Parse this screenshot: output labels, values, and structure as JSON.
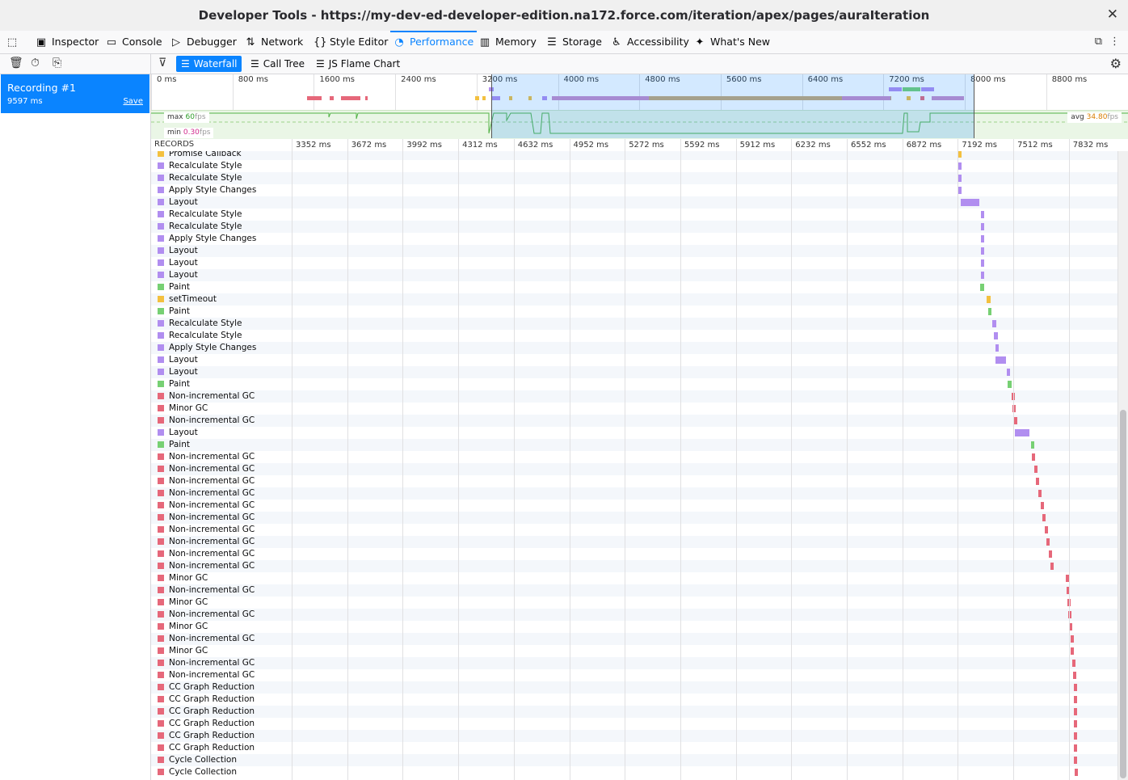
{
  "window": {
    "title": "Developer Tools - https://my-dev-ed-developer-edition.na172.force.com/iteration/apex/pages/auraIteration",
    "close_icon": "close-icon"
  },
  "tabs": [
    {
      "label": "Inspector",
      "icon": "inspector-icon"
    },
    {
      "label": "Console",
      "icon": "console-icon"
    },
    {
      "label": "Debugger",
      "icon": "debugger-icon"
    },
    {
      "label": "Network",
      "icon": "network-icon"
    },
    {
      "label": "Style Editor",
      "icon": "style-editor-icon"
    },
    {
      "label": "Performance",
      "icon": "performance-icon",
      "selected": true
    },
    {
      "label": "Memory",
      "icon": "memory-icon"
    },
    {
      "label": "Storage",
      "icon": "storage-icon"
    },
    {
      "label": "Accessibility",
      "icon": "accessibility-icon"
    },
    {
      "label": "What's New",
      "icon": "whats-new-icon"
    }
  ],
  "subtabs": [
    {
      "label": "Waterfall",
      "selected": true
    },
    {
      "label": "Call Tree"
    },
    {
      "label": "JS Flame Chart"
    }
  ],
  "recording": {
    "name": "Recording #1",
    "duration": "9597 ms",
    "save": "Save"
  },
  "overview": {
    "ticks": [
      "0 ms",
      "800 ms",
      "1600 ms",
      "2400 ms",
      "3200 ms",
      "4000 ms",
      "4800 ms",
      "5600 ms",
      "6400 ms",
      "7200 ms",
      "8000 ms",
      "8800 ms"
    ],
    "fps": {
      "max_label": "max",
      "max_value": "60",
      "min_label": "min",
      "min_value": "0.30",
      "avg_label": "avg",
      "avg_value": "34.80",
      "unit": "fps"
    }
  },
  "waterfall": {
    "header": "RECORDS",
    "ticks": [
      "3352 ms",
      "3672 ms",
      "3992 ms",
      "4312 ms",
      "4632 ms",
      "4952 ms",
      "5272 ms",
      "5592 ms",
      "5912 ms",
      "6232 ms",
      "6552 ms",
      "6872 ms",
      "7192 ms",
      "7512 ms",
      "7832 ms"
    ],
    "colors": {
      "js": "#f3c03f",
      "style": "#b18ef0",
      "paint": "#77d073",
      "gc": "#e6687a"
    },
    "records": [
      {
        "name": "Promise Callback",
        "cat": "js",
        "start": 7192,
        "dur": 20
      },
      {
        "name": "Recalculate Style",
        "cat": "style",
        "start": 7192,
        "dur": 20
      },
      {
        "name": "Recalculate Style",
        "cat": "style",
        "start": 7192,
        "dur": 20
      },
      {
        "name": "Apply Style Changes",
        "cat": "style",
        "start": 7192,
        "dur": 20
      },
      {
        "name": "Layout",
        "cat": "style",
        "start": 7210,
        "dur": 105
      },
      {
        "name": "Recalculate Style",
        "cat": "style",
        "start": 7325,
        "dur": 20
      },
      {
        "name": "Recalculate Style",
        "cat": "style",
        "start": 7325,
        "dur": 20
      },
      {
        "name": "Apply Style Changes",
        "cat": "style",
        "start": 7325,
        "dur": 20
      },
      {
        "name": "Layout",
        "cat": "style",
        "start": 7325,
        "dur": 20
      },
      {
        "name": "Layout",
        "cat": "style",
        "start": 7325,
        "dur": 20
      },
      {
        "name": "Layout",
        "cat": "style",
        "start": 7325,
        "dur": 20
      },
      {
        "name": "Paint",
        "cat": "paint",
        "start": 7322,
        "dur": 20
      },
      {
        "name": "setTimeout",
        "cat": "js",
        "start": 7360,
        "dur": 20
      },
      {
        "name": "Paint",
        "cat": "paint",
        "start": 7365,
        "dur": 20
      },
      {
        "name": "Recalculate Style",
        "cat": "style",
        "start": 7392,
        "dur": 20
      },
      {
        "name": "Recalculate Style",
        "cat": "style",
        "start": 7402,
        "dur": 20
      },
      {
        "name": "Apply Style Changes",
        "cat": "style",
        "start": 7410,
        "dur": 20
      },
      {
        "name": "Layout",
        "cat": "style",
        "start": 7410,
        "dur": 60
      },
      {
        "name": "Layout",
        "cat": "style",
        "start": 7475,
        "dur": 20
      },
      {
        "name": "Paint",
        "cat": "paint",
        "start": 7480,
        "dur": 20
      },
      {
        "name": "Non-incremental GC",
        "cat": "gc",
        "start": 7500,
        "dur": 18
      },
      {
        "name": "Minor GC",
        "cat": "gc",
        "start": 7505,
        "dur": 18
      },
      {
        "name": "Non-incremental GC",
        "cat": "gc",
        "start": 7515,
        "dur": 18
      },
      {
        "name": "Layout",
        "cat": "style",
        "start": 7522,
        "dur": 85
      },
      {
        "name": "Paint",
        "cat": "paint",
        "start": 7612,
        "dur": 20
      },
      {
        "name": "Non-incremental GC",
        "cat": "gc",
        "start": 7620,
        "dur": 18
      },
      {
        "name": "Non-incremental GC",
        "cat": "gc",
        "start": 7632,
        "dur": 18
      },
      {
        "name": "Non-incremental GC",
        "cat": "gc",
        "start": 7644,
        "dur": 18
      },
      {
        "name": "Non-incremental GC",
        "cat": "gc",
        "start": 7656,
        "dur": 18
      },
      {
        "name": "Non-incremental GC",
        "cat": "gc",
        "start": 7668,
        "dur": 18
      },
      {
        "name": "Non-incremental GC",
        "cat": "gc",
        "start": 7680,
        "dur": 18
      },
      {
        "name": "Non-incremental GC",
        "cat": "gc",
        "start": 7692,
        "dur": 18
      },
      {
        "name": "Non-incremental GC",
        "cat": "gc",
        "start": 7704,
        "dur": 18
      },
      {
        "name": "Non-incremental GC",
        "cat": "gc",
        "start": 7716,
        "dur": 18
      },
      {
        "name": "Non-incremental GC",
        "cat": "gc",
        "start": 7728,
        "dur": 18
      },
      {
        "name": "Minor GC",
        "cat": "gc",
        "start": 7812,
        "dur": 18
      },
      {
        "name": "Non-incremental GC",
        "cat": "gc",
        "start": 7818,
        "dur": 18
      },
      {
        "name": "Minor GC",
        "cat": "gc",
        "start": 7822,
        "dur": 18
      },
      {
        "name": "Non-incremental GC",
        "cat": "gc",
        "start": 7830,
        "dur": 18
      },
      {
        "name": "Minor GC",
        "cat": "gc",
        "start": 7834,
        "dur": 18
      },
      {
        "name": "Non-incremental GC",
        "cat": "gc",
        "start": 7840,
        "dur": 18
      },
      {
        "name": "Minor GC",
        "cat": "gc",
        "start": 7844,
        "dur": 18
      },
      {
        "name": "Non-incremental GC",
        "cat": "gc",
        "start": 7852,
        "dur": 18
      },
      {
        "name": "Non-incremental GC",
        "cat": "gc",
        "start": 7858,
        "dur": 18
      },
      {
        "name": "CC Graph Reduction",
        "cat": "gc",
        "start": 7860,
        "dur": 18
      },
      {
        "name": "CC Graph Reduction",
        "cat": "gc",
        "start": 7860,
        "dur": 18
      },
      {
        "name": "CC Graph Reduction",
        "cat": "gc",
        "start": 7862,
        "dur": 18
      },
      {
        "name": "CC Graph Reduction",
        "cat": "gc",
        "start": 7862,
        "dur": 18
      },
      {
        "name": "CC Graph Reduction",
        "cat": "gc",
        "start": 7862,
        "dur": 18
      },
      {
        "name": "CC Graph Reduction",
        "cat": "gc",
        "start": 7862,
        "dur": 18
      },
      {
        "name": "Cycle Collection",
        "cat": "gc",
        "start": 7862,
        "dur": 18
      },
      {
        "name": "Cycle Collection",
        "cat": "gc",
        "start": 7866,
        "dur": 18
      }
    ]
  }
}
